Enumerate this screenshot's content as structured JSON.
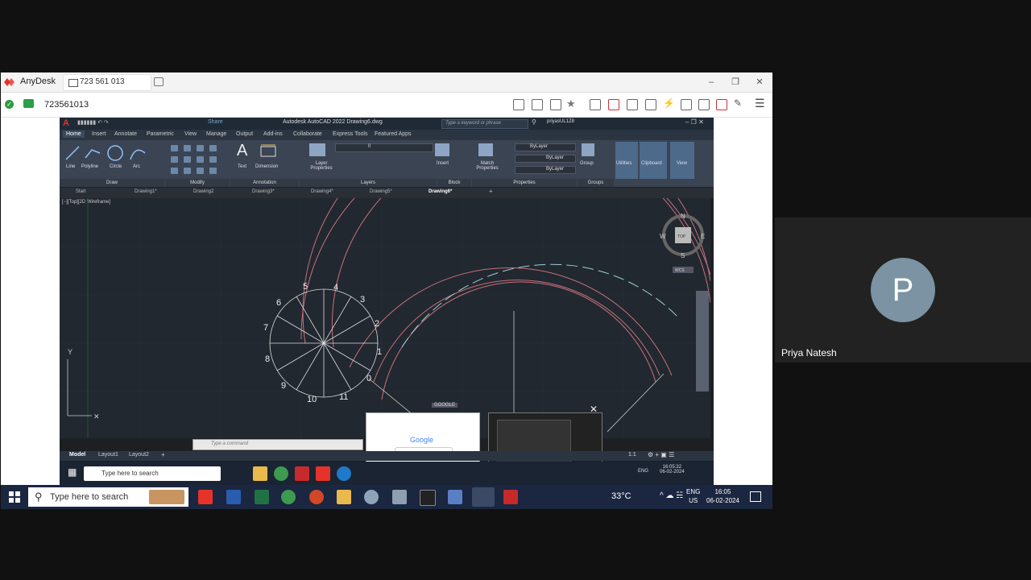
{
  "anydesk": {
    "brand": "AnyDesk",
    "tab_address": "723 561 013",
    "session_id": "723561013",
    "window_controls": [
      "minimize-icon",
      "restore-icon",
      "close-icon"
    ]
  },
  "autocad": {
    "title": "Autodesk AutoCAD 2022    Drawing6.dwg",
    "search_placeholder": "Type a keyword or phrase",
    "user": "priyasUL1Z8",
    "share_label": "Share",
    "ribbon_tabs": [
      "Home",
      "Insert",
      "Annotate",
      "Parametric",
      "View",
      "Manage",
      "Output",
      "Add-ins",
      "Collaborate",
      "Express Tools",
      "Featured Apps"
    ],
    "draw_tools": [
      "Line",
      "Polyline",
      "Circle",
      "Arc"
    ],
    "panels": [
      "Draw",
      "Modify",
      "Annotation",
      "Layers",
      "Block",
      "Properties",
      "Groups"
    ],
    "annotation_tools": [
      "Text",
      "Dimension"
    ],
    "layer_tool": "Layer Properties",
    "insert_tool": "Insert",
    "match_tool": "Match Properties",
    "group_tool": "Group",
    "utilities": "Utilities",
    "clipboard": "Clipboard",
    "view": "View",
    "layer_value": "0",
    "bylayer": [
      "ByLayer",
      "ByLayer",
      "ByLayer"
    ],
    "doc_tabs": [
      "Start",
      "Drawing1*",
      "Drawing2",
      "Drawing3*",
      "Drawing4*",
      "Drawing5*",
      "Drawing6*"
    ],
    "viewport_label": "[−][Top][2D Wireframe]",
    "viewcube": {
      "n": "N",
      "s": "S",
      "e": "E",
      "w": "W",
      "top": "TOP",
      "wcs": "WCS"
    },
    "circle_labels": [
      "0",
      "1",
      "2",
      "3",
      "4",
      "5",
      "6",
      "7",
      "8",
      "9",
      "10",
      "11"
    ],
    "ucs_y": "Y",
    "command_placeholder": "Type a command",
    "layout_tabs": [
      "Model",
      "Layout1",
      "Layout2"
    ],
    "scale": "1:1",
    "lang": "ENG",
    "preview_label": "GOOGLE",
    "google_text": "Google"
  },
  "remote_taskbar": {
    "search": "Type here to search",
    "time": "16:05:32",
    "date": "06-02-2024",
    "lang": "ENG"
  },
  "taskbar": {
    "search": "Type here to search",
    "weather": "33°C",
    "lang": "ENG",
    "region": "US",
    "time": "16:05",
    "date": "06-02-2024"
  },
  "participant": {
    "initial": "P",
    "name": "Priya Natesh",
    "avatar_color": "#7b93a3"
  }
}
